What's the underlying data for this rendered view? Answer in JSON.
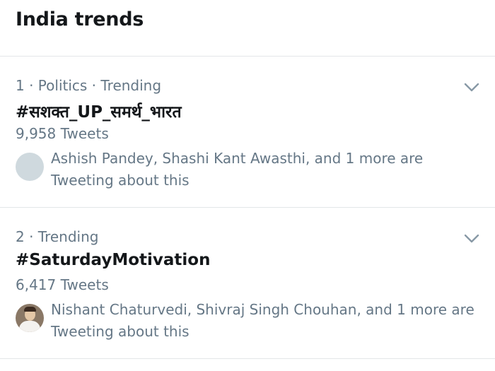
{
  "header": {
    "title": "India trends"
  },
  "trends": [
    {
      "meta": "1 · Politics · Trending",
      "name": "#सशक्त_UP_समर्थ_भारत",
      "count": "9,958 Tweets",
      "social_context": "Ashish Pandey, Shashi Kant Awasthi, and 1 more are Tweeting about this",
      "avatar": "placeholder-gray"
    },
    {
      "meta": "2 · Trending",
      "name": "#SaturdayMotivation",
      "count": "6,417 Tweets",
      "social_context": "Nishant Chaturvedi, Shivraj Singh Chouhan, and 1 more are Tweeting about this",
      "avatar": "profile-photo"
    }
  ],
  "colors": {
    "primary_text": "#14171a",
    "secondary_text": "#657786",
    "divider": "#e3e6e8",
    "chevron": "#8899a6",
    "avatar_placeholder": "#cfd9de"
  },
  "icons": {
    "more_options": "chevron-down-icon"
  }
}
